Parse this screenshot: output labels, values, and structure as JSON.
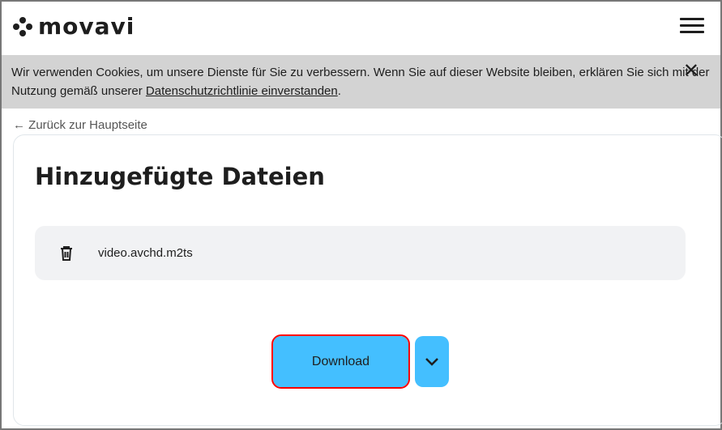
{
  "header": {
    "logo": "movavi"
  },
  "cookie": {
    "text": "Wir verwenden Cookies, um unsere Dienste für Sie zu verbessern. Wenn Sie auf dieser Website bleiben, erklären Sie sich mit der Nutzung gemäß unserer ",
    "link": "Datenschutzrichtlinie einverstanden",
    "end": ".",
    "close": "✕"
  },
  "back": {
    "label": "← Zurück zur Hauptseite"
  },
  "main": {
    "title": "Hinzugefügte Dateien",
    "files": [
      {
        "name": "video.avchd.m2ts"
      }
    ],
    "download_label": "Download"
  }
}
